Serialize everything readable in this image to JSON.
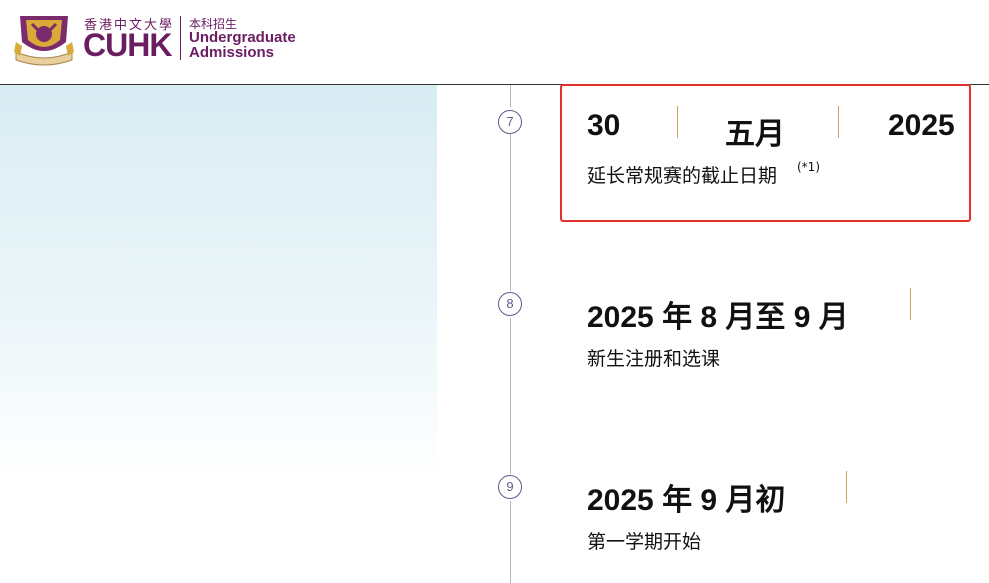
{
  "header": {
    "logo_chinese": "香港中文大學",
    "logo_english": "CUHK",
    "admissions_chinese": "本科招生",
    "admissions_english": "Undergraduate Admissions"
  },
  "colors": {
    "brand_purple": "#6b1d62",
    "gold": "#c9a55a",
    "highlight_red": "#e3312d",
    "step_circle": "#5f5a8a"
  },
  "timeline": [
    {
      "step": "7",
      "day": "30",
      "month": "五月",
      "year": "2025",
      "description": "延长常规赛的截止日期",
      "footnote": "(*1)"
    },
    {
      "step": "8",
      "date": "2025 年 8 月至 9 月",
      "description": "新生注册和选课"
    },
    {
      "step": "9",
      "date": "2025 年 9 月初",
      "description": "第一学期开始"
    }
  ]
}
